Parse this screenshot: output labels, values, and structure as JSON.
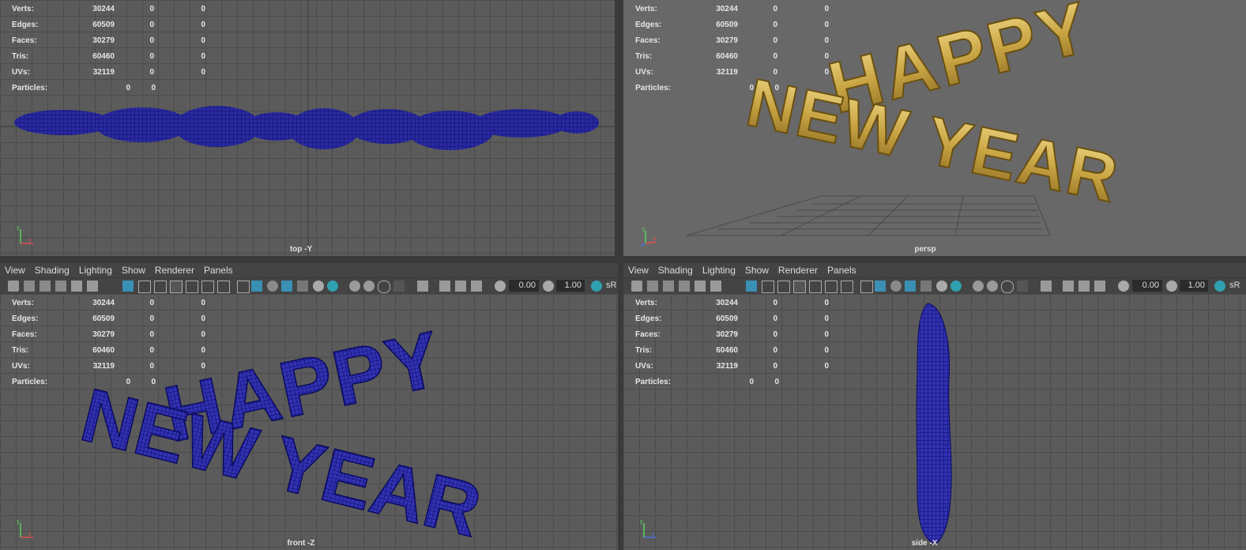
{
  "stats": {
    "labels": [
      "Verts:",
      "Edges:",
      "Faces:",
      "Tris:",
      "UVs:"
    ],
    "rows": [
      {
        "label": "Verts:",
        "a": "30244",
        "b": "0",
        "c": "0"
      },
      {
        "label": "Edges:",
        "a": "60509",
        "b": "0",
        "c": "0"
      },
      {
        "label": "Faces:",
        "a": "30279",
        "b": "0",
        "c": "0"
      },
      {
        "label": "Tris:",
        "a": "60460",
        "b": "0",
        "c": "0"
      },
      {
        "label": "UVs:",
        "a": "32119",
        "b": "0",
        "c": "0"
      }
    ],
    "particles": {
      "label": "Particles:",
      "a": "0",
      "b": "0"
    }
  },
  "viewports": {
    "top": {
      "name": "top -Y"
    },
    "persp": {
      "name": "persp"
    },
    "front": {
      "name": "front -Z"
    },
    "side": {
      "name": "side -X"
    }
  },
  "panel_menu": [
    "View",
    "Shading",
    "Lighting",
    "Show",
    "Renderer",
    "Panels"
  ],
  "toolbar": {
    "near_clip": "0.00",
    "far_clip": "1.00",
    "srgb": "sR"
  },
  "model_text": {
    "line1": "HAPPY",
    "line2": "NEW YEAR"
  },
  "colors": {
    "wire": "#1c1c8c",
    "gold": "#d6b85a",
    "viewport_bg": "#5b5b5b",
    "toolbar_bg": "#444444"
  }
}
